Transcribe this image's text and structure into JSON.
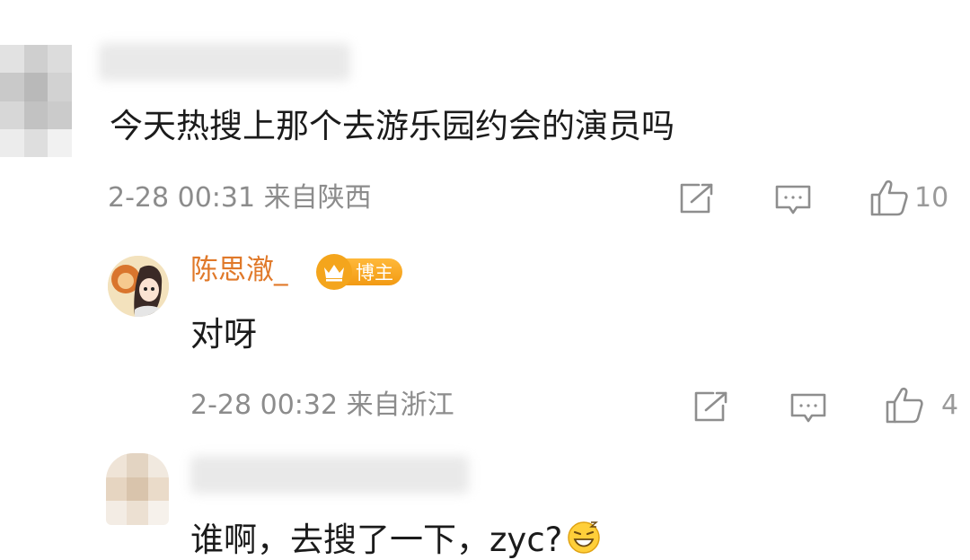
{
  "comments": [
    {
      "text": "今天热搜上那个去游乐园约会的演员吗",
      "time_location": "2-28 00:31 来自陕西",
      "likes": "10"
    },
    {
      "username": "陈思澈_",
      "badge": "博主",
      "text": "对呀",
      "time_location": "2-28 00:32 来自浙江",
      "likes": "4"
    },
    {
      "text": "谁啊，去搜了一下，zyc?"
    }
  ],
  "icons": {
    "share": "share-icon",
    "comment": "comment-icon",
    "like": "thumbs-up-icon",
    "emoji": "grin-emoji-icon",
    "crown": "crown-icon"
  },
  "colors": {
    "username": "#e0792a",
    "meta": "#8c8c8c",
    "badge": "#f29a13"
  }
}
